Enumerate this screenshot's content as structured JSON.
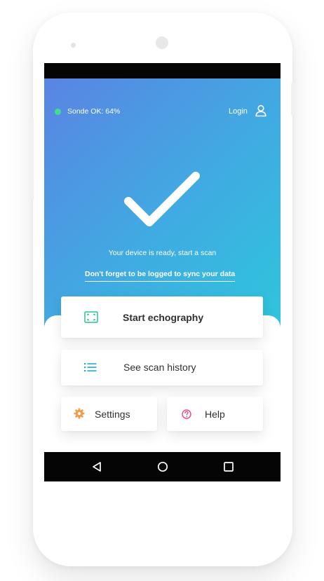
{
  "status": {
    "sonde_text": "Sonde OK: 64%",
    "sonde_dot_color": "#3ee08e"
  },
  "header": {
    "login_label": "Login",
    "user_icon": "user-icon"
  },
  "hero": {
    "status_icon": "checkmark-icon",
    "ready_text": "Your device is ready, start a scan",
    "sync_link": "Don't forget to be logged to sync your data",
    "gradient_start": "#5a84e3",
    "gradient_end": "#2ec5dd"
  },
  "actions": {
    "start": {
      "label": "Start echography",
      "icon": "scan-frame-icon",
      "icon_color": "#2bc38e"
    },
    "history": {
      "label": "See scan history",
      "icon": "list-icon",
      "icon_color": "#21a8d9"
    },
    "settings": {
      "label": "Settings",
      "icon": "gear-icon",
      "icon_color": "#f39a4a"
    },
    "help": {
      "label": "Help",
      "icon": "help-icon",
      "icon_color": "#f2457a"
    }
  },
  "android_nav": {
    "back": "back-icon",
    "home": "home-icon",
    "recent": "recent-apps-icon"
  }
}
